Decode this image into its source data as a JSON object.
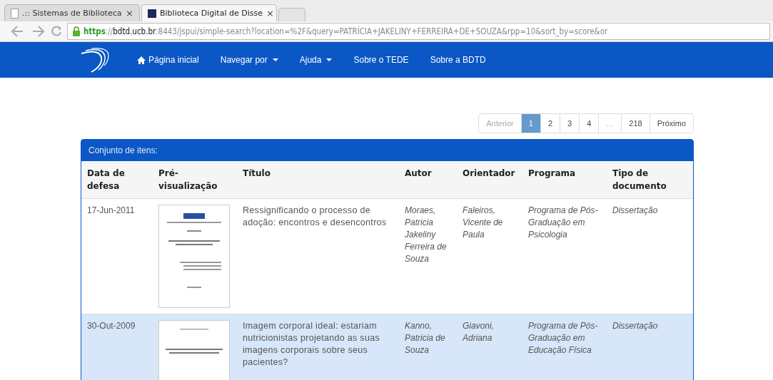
{
  "browser": {
    "tabs": [
      {
        "title": ".:: Sistemas de Biblioteca",
        "close": "×",
        "selected": false
      },
      {
        "title": "Biblioteca Digital de Disse",
        "close": "×",
        "selected": true
      }
    ],
    "address": {
      "scheme": "https",
      "separator": "://",
      "host": "bdtd.ucb.br",
      "rest": ":8443/jspui/simple-search?location=%2F&query=PATRÍCIA+JAKELINY+FERREIRA+DE+SOUZA&rpp=10&sort_by=score&or"
    }
  },
  "navbar": {
    "items": [
      {
        "label": "Página inicial",
        "kind": "home"
      },
      {
        "label": "Navegar por",
        "kind": "dropdown"
      },
      {
        "label": "Ajuda",
        "kind": "dropdown"
      },
      {
        "label": "Sobre o TEDE",
        "kind": "link"
      },
      {
        "label": "Sobre a BDTD",
        "kind": "link"
      }
    ]
  },
  "pagination": [
    {
      "label": "Anterior",
      "selected": false,
      "disabled": true
    },
    {
      "label": "1",
      "selected": true,
      "disabled": false
    },
    {
      "label": "2",
      "selected": false,
      "disabled": false
    },
    {
      "label": "3",
      "selected": false,
      "disabled": false
    },
    {
      "label": "4",
      "selected": false,
      "disabled": false
    },
    {
      "label": "…",
      "selected": false,
      "disabled": true
    },
    {
      "label": "218",
      "selected": false,
      "disabled": false
    },
    {
      "label": "Próximo",
      "selected": false,
      "disabled": false
    }
  ],
  "results": {
    "title": "Conjunto de itens:",
    "columns": [
      "Data de defesa",
      "Pré-visualização",
      "Título",
      "Autor",
      "Orientador",
      "Programa",
      "Tipo de documento"
    ],
    "rows": [
      {
        "date": "17-Jun-2011",
        "title": "Ressignificando o processo de adoção: encontros e desencontros",
        "author": "Moraes, Patricia Jakeliny Ferreira de Souza",
        "advisor": "Faleiros, Vicente de Paula",
        "program": "Programa de Pós-Graduação em Psicologia",
        "type": "Dissertação",
        "selected": false
      },
      {
        "date": "30-Out-2009",
        "title": "Imagem corporal ideal: estariam nutricionistas projetando as suas imagens corporais sobre seus pacientes?",
        "author": "Kanno, Patricia de Souza",
        "advisor": "Giavoni, Adriana",
        "program": "Programa de Pós-Graduação em Educação Física",
        "type": "Dissertação",
        "selected": true
      }
    ]
  }
}
